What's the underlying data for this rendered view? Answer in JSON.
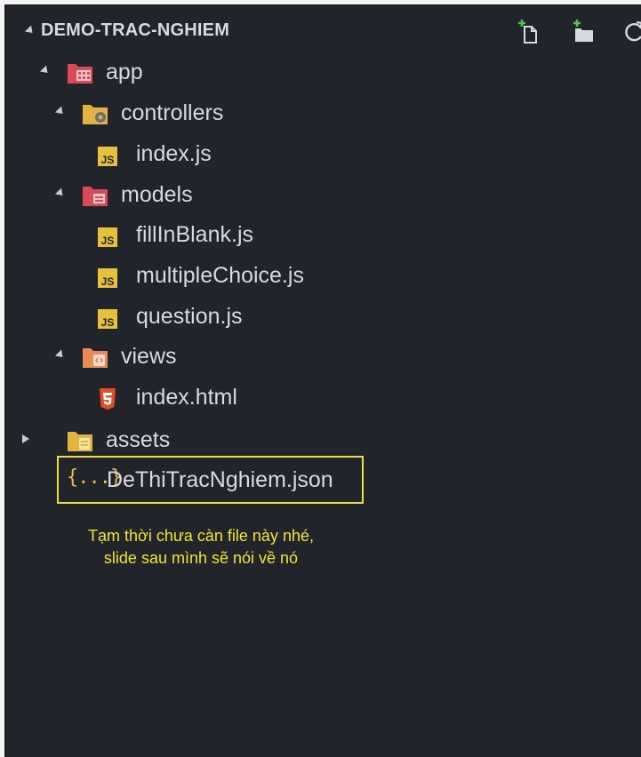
{
  "explorer": {
    "project_title": "DEMO-TRAC-NGHIEM",
    "header_actions": [
      "new-file-icon",
      "new-folder-icon",
      "refresh-icon"
    ],
    "tree": [
      {
        "label": "app",
        "type": "folder",
        "expanded": true,
        "depth": 0
      },
      {
        "label": "controllers",
        "type": "folder",
        "expanded": true,
        "depth": 1
      },
      {
        "label": "index.js",
        "type": "js-file",
        "depth": 2
      },
      {
        "label": "models",
        "type": "folder",
        "expanded": true,
        "depth": 1
      },
      {
        "label": "fillInBlank.js",
        "type": "js-file",
        "depth": 2
      },
      {
        "label": "multipleChoice.js",
        "type": "js-file",
        "depth": 2
      },
      {
        "label": "question.js",
        "type": "js-file",
        "depth": 2
      },
      {
        "label": "views",
        "type": "folder",
        "expanded": true,
        "depth": 1
      },
      {
        "label": "index.html",
        "type": "html-file",
        "depth": 2
      },
      {
        "label": "assets",
        "type": "folder",
        "expanded": false,
        "depth": 0
      },
      {
        "label": "DeThiTracNghiem.json",
        "type": "json-file",
        "depth": 0,
        "highlighted": true
      }
    ],
    "js_badge_text": "JS",
    "json_icon_text": "{...}"
  },
  "annotation": {
    "line1": "Tạm thời chưa càn file này nhé,",
    "line2": "slide sau mình sẽ nói về nó"
  },
  "colors": {
    "panel_bg": "#21252b",
    "text": "#d7dae0",
    "js_yellow": "#e5c13c",
    "html_orange": "#e44d26",
    "highlight_yellow": "#ede02c"
  }
}
